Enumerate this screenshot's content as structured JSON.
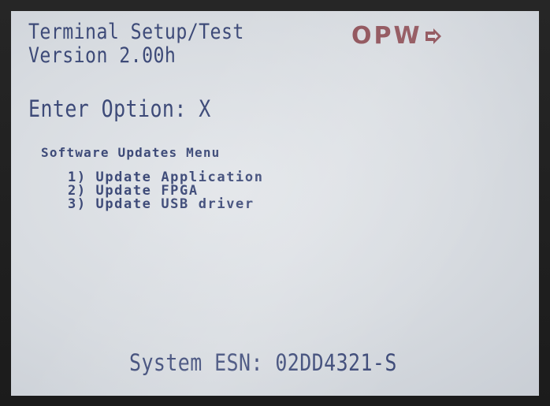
{
  "header": {
    "title_line1": "Terminal Setup/Test",
    "title_line2": "Version 2.00h",
    "logo_text": "OPW"
  },
  "prompt": {
    "text": "Enter Option: X"
  },
  "menu": {
    "title": "Software Updates Menu",
    "items": [
      {
        "label": "1) Update Application"
      },
      {
        "label": "2) Update FPGA"
      },
      {
        "label": "3) Update USB driver"
      }
    ]
  },
  "footer": {
    "esn_text": "System ESN: 02DD4321-S"
  },
  "colors": {
    "lcd_text": "#3d4a78",
    "logo": "#8a4a52",
    "screen_bg": "#dde1e6",
    "bezel": "#1f1f1f"
  },
  "icons": {
    "logo_arrow": "arrow-right-icon"
  }
}
